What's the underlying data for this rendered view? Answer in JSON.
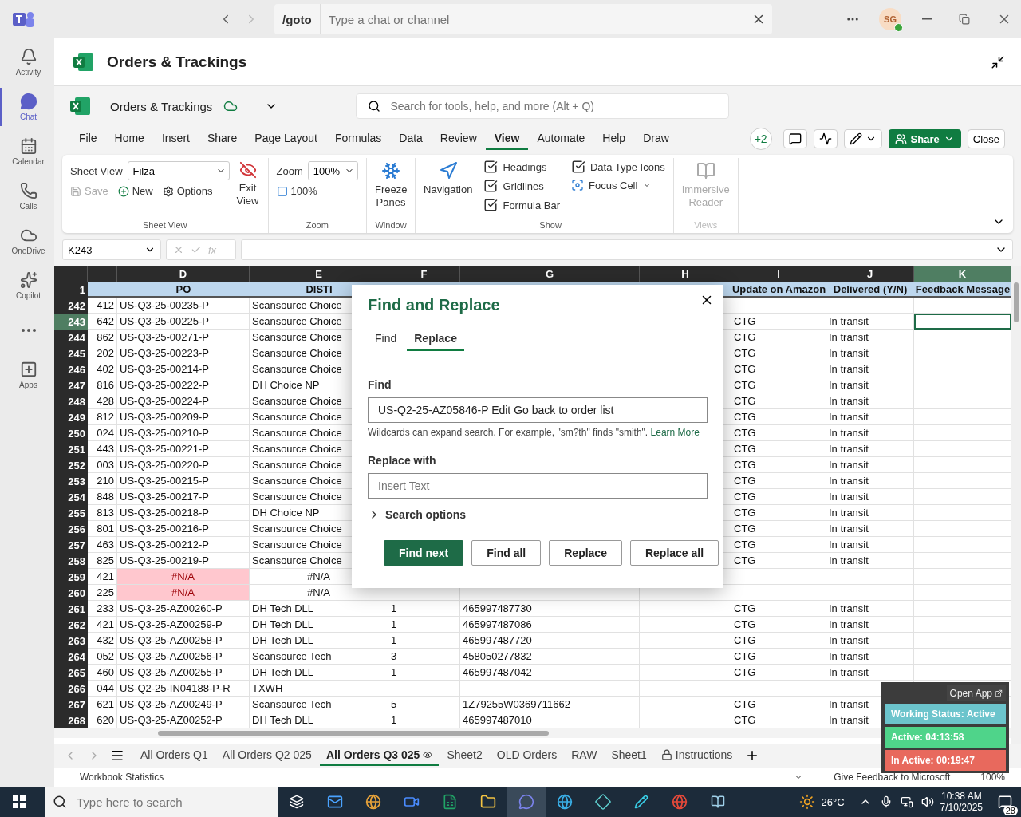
{
  "titlebar": {
    "command": "/goto",
    "search_placeholder": "Type a chat or channel",
    "avatar": "SG"
  },
  "rail": [
    {
      "label": "Activity",
      "kind": "bell",
      "selected": false
    },
    {
      "label": "Chat",
      "kind": "chat",
      "selected": true
    },
    {
      "label": "Calendar",
      "kind": "calendar",
      "selected": false
    },
    {
      "label": "Calls",
      "kind": "phone",
      "selected": false
    },
    {
      "label": "OneDrive",
      "kind": "cloud",
      "selected": false
    },
    {
      "label": "Copilot",
      "kind": "copilot",
      "selected": false
    },
    {
      "kind": "more",
      "selected": false
    },
    {
      "label": "Apps",
      "kind": "apps",
      "selected": false
    }
  ],
  "header": {
    "title": "Orders & Trackings"
  },
  "workbook": {
    "name": "Orders & Trackings",
    "search_placeholder": "Search for tools, help, and more (Alt + Q)"
  },
  "menu": [
    {
      "label": "File",
      "selected": false
    },
    {
      "label": "Home",
      "selected": false
    },
    {
      "label": "Insert",
      "selected": false
    },
    {
      "label": "Share",
      "selected": false
    },
    {
      "label": "Page Layout",
      "selected": false
    },
    {
      "label": "Formulas",
      "selected": false
    },
    {
      "label": "Data",
      "selected": false
    },
    {
      "label": "Review",
      "selected": false
    },
    {
      "label": "View",
      "selected": true
    },
    {
      "label": "Automate",
      "selected": false
    },
    {
      "label": "Help",
      "selected": false
    },
    {
      "label": "Draw",
      "selected": false
    }
  ],
  "collab": {
    "count": "+2",
    "share": "Share",
    "close": "Close"
  },
  "ribbon": {
    "sheet_view": {
      "label": "Sheet View",
      "value": "Filza",
      "save": "Save",
      "save_disabled": true,
      "new": "New",
      "options": "Options",
      "exit": "Exit View",
      "group": "Sheet View"
    },
    "zoom": {
      "label": "Zoom",
      "value": "100%",
      "reset": "100%",
      "group": "Zoom"
    },
    "window": {
      "freeze": "Freeze Panes",
      "group": "Window"
    },
    "navigation": "Navigation",
    "show": {
      "group": "Show",
      "checks": [
        {
          "label": "Headings",
          "checked": true
        },
        {
          "label": "Gridlines",
          "checked": true
        },
        {
          "label": "Formula Bar",
          "checked": true
        },
        {
          "label": "Data Type Icons",
          "checked": true
        }
      ],
      "focus": "Focus Cell"
    },
    "views": {
      "reader": "Immersive Reader",
      "group": "Views",
      "disabled": true
    }
  },
  "formula_bar": {
    "name_box": "K243",
    "fx": "fx"
  },
  "columns": [
    {
      "letter": "D",
      "selected": false
    },
    {
      "letter": "E",
      "selected": false
    },
    {
      "letter": "F",
      "selected": false
    },
    {
      "letter": "G",
      "selected": false
    },
    {
      "letter": "H",
      "selected": false
    },
    {
      "letter": "I",
      "selected": false
    },
    {
      "letter": "J",
      "selected": false
    },
    {
      "letter": "K",
      "selected": true
    }
  ],
  "header_row": {
    "row": "1",
    "d": "PO",
    "e": "DISTI",
    "i": "Update on Amazon",
    "j": "Delivered (Y/N)",
    "k": "Feedback Message"
  },
  "rows": [
    {
      "row": "242",
      "selected": false,
      "error": false,
      "c": "412",
      "d": "US-Q3-25-00235-P",
      "e": "Scansource Choice"
    },
    {
      "row": "243",
      "selected": true,
      "error": false,
      "c": "642",
      "d": "US-Q3-25-00225-P",
      "e": "Scansource Choice",
      "i": "CTG",
      "j": "In transit"
    },
    {
      "row": "244",
      "selected": false,
      "error": false,
      "c": "862",
      "d": "US-Q3-25-00271-P",
      "e": "Scansource Choice",
      "i": "CTG",
      "j": "In transit"
    },
    {
      "row": "245",
      "selected": false,
      "error": false,
      "c": "202",
      "d": "US-Q3-25-00223-P",
      "e": "Scansource Choice",
      "i": "CTG",
      "j": "In transit"
    },
    {
      "row": "246",
      "selected": false,
      "error": false,
      "c": "402",
      "d": "US-Q3-25-00214-P",
      "e": "Scansource Choice",
      "i": "CTG",
      "j": "In transit"
    },
    {
      "row": "247",
      "selected": false,
      "error": false,
      "c": "816",
      "d": "US-Q3-25-00222-P",
      "e": "DH Choice NP",
      "i": "CTG",
      "j": "In transit"
    },
    {
      "row": "248",
      "selected": false,
      "error": false,
      "c": "428",
      "d": "US-Q3-25-00224-P",
      "e": "Scansource Choice",
      "i": "CTG",
      "j": "In transit"
    },
    {
      "row": "249",
      "selected": false,
      "error": false,
      "c": "812",
      "d": "US-Q3-25-00209-P",
      "e": "Scansource Choice",
      "i": "CTG",
      "j": "In transit"
    },
    {
      "row": "250",
      "selected": false,
      "error": false,
      "c": "024",
      "d": "US-Q3-25-00210-P",
      "e": "Scansource Choice",
      "i": "CTG",
      "j": "In transit"
    },
    {
      "row": "251",
      "selected": false,
      "error": false,
      "c": "443",
      "d": "US-Q3-25-00221-P",
      "e": "Scansource Choice",
      "i": "CTG",
      "j": "In transit"
    },
    {
      "row": "252",
      "selected": false,
      "error": false,
      "c": "003",
      "d": "US-Q3-25-00220-P",
      "e": "Scansource Choice",
      "i": "CTG",
      "j": "In transit"
    },
    {
      "row": "253",
      "selected": false,
      "error": false,
      "c": "210",
      "d": "US-Q3-25-00215-P",
      "e": "Scansource Choice",
      "i": "CTG",
      "j": "In transit"
    },
    {
      "row": "254",
      "selected": false,
      "error": false,
      "c": "848",
      "d": "US-Q3-25-00217-P",
      "e": "Scansource Choice",
      "i": "CTG",
      "j": "In transit"
    },
    {
      "row": "255",
      "selected": false,
      "error": false,
      "c": "813",
      "d": "US-Q3-25-00218-P",
      "e": "DH Choice NP",
      "i": "CTG",
      "j": "In transit"
    },
    {
      "row": "256",
      "selected": false,
      "error": false,
      "c": "801",
      "d": "US-Q3-25-00216-P",
      "e": "Scansource Choice",
      "i": "CTG",
      "j": "In transit"
    },
    {
      "row": "257",
      "selected": false,
      "error": false,
      "c": "463",
      "d": "US-Q3-25-00212-P",
      "e": "Scansource Choice",
      "i": "CTG",
      "j": "In transit"
    },
    {
      "row": "258",
      "selected": false,
      "error": false,
      "c": "825",
      "d": "US-Q3-25-00219-P",
      "e": "Scansource Choice",
      "i": "CTG",
      "j": "In transit"
    },
    {
      "row": "259",
      "selected": false,
      "error": true,
      "c": "421",
      "d": "#N/A",
      "e": "#N/A"
    },
    {
      "row": "260",
      "selected": false,
      "error": true,
      "c": "225",
      "d": "#N/A",
      "e": "#N/A"
    },
    {
      "row": "261",
      "selected": false,
      "error": false,
      "c": "233",
      "d": "US-Q3-25-AZ00260-P",
      "e": "DH Tech DLL",
      "f": "1",
      "g": "465997487730",
      "i": "CTG",
      "j": "In transit"
    },
    {
      "row": "262",
      "selected": false,
      "error": false,
      "c": "421",
      "d": "US-Q3-25-AZ00259-P",
      "e": "DH Tech DLL",
      "f": "1",
      "g": "465997487086",
      "i": "CTG",
      "j": "In transit"
    },
    {
      "row": "263",
      "selected": false,
      "error": false,
      "c": "432",
      "d": "US-Q3-25-AZ00258-P",
      "e": "DH Tech DLL",
      "f": "1",
      "g": "465997487720",
      "i": "CTG",
      "j": "In transit"
    },
    {
      "row": "264",
      "selected": false,
      "error": false,
      "c": "052",
      "d": "US-Q3-25-AZ00256-P",
      "e": "Scansource Tech",
      "f": "3",
      "g": "458050277832",
      "i": "CTG",
      "j": "In transit"
    },
    {
      "row": "265",
      "selected": false,
      "error": false,
      "c": "460",
      "d": "US-Q3-25-AZ00255-P",
      "e": "DH Tech DLL",
      "f": "1",
      "g": "465997487042",
      "i": "CTG",
      "j": "In transit"
    },
    {
      "row": "266",
      "selected": false,
      "error": false,
      "c": "044",
      "d": "US-Q2-25-IN04188-P-R",
      "e": "TXWH"
    },
    {
      "row": "267",
      "selected": false,
      "error": false,
      "c": "621",
      "d": "US-Q3-25-AZ00249-P",
      "e": "Scansource Tech",
      "f": "5",
      "g": "1Z79255W0369711662",
      "i": "CTG",
      "j": "In transit"
    },
    {
      "row": "268",
      "selected": false,
      "error": false,
      "c": "620",
      "d": "US-Q3-25-AZ00252-P",
      "e": "DH Tech DLL",
      "f": "1",
      "g": "465997487010",
      "i": "CTG",
      "j": "In transit"
    }
  ],
  "dialog": {
    "title": "Find and Replace",
    "tabs": [
      {
        "label": "Find",
        "selected": false
      },
      {
        "label": "Replace",
        "selected": true
      }
    ],
    "find_label": "Find",
    "find_value": "US-Q2-25-AZ05846-P Edit Go back to order list",
    "hint": "Wildcards can expand search. For example, \"sm?th\" finds \"smith\".",
    "hint_link": "Learn More",
    "replace_label": "Replace with",
    "replace_placeholder": "Insert Text",
    "search_options": "Search options",
    "search_options_expanded": false,
    "buttons": [
      {
        "label": "Find next",
        "kind": "primary"
      },
      {
        "label": "Find all",
        "kind": "secondary"
      },
      {
        "label": "Replace",
        "kind": "secondary"
      },
      {
        "label": "Replace all",
        "kind": "secondary"
      }
    ]
  },
  "sheets": [
    {
      "label": "All Orders Q1",
      "selected": false,
      "kind": "plain"
    },
    {
      "label": "All Orders Q2 025",
      "selected": false,
      "kind": "plain"
    },
    {
      "label": "All Orders Q3 025",
      "selected": true,
      "kind": "view"
    },
    {
      "label": "Sheet2",
      "selected": false,
      "kind": "plain"
    },
    {
      "label": "OLD Orders",
      "selected": false,
      "kind": "plain"
    },
    {
      "label": "RAW",
      "selected": false,
      "kind": "plain"
    },
    {
      "label": "Sheet1",
      "selected": false,
      "kind": "plain"
    },
    {
      "label": "Instructions",
      "selected": false,
      "kind": "locked"
    }
  ],
  "status_bar": {
    "left": "Workbook Statistics",
    "feedback": "Give Feedback to Microsoft",
    "zoom": "100%"
  },
  "widget": {
    "open": "Open App",
    "items": [
      {
        "label": "Working Status: Active",
        "color": "#6cc4cc"
      },
      {
        "label": "Active: 04:13:58",
        "color": "#4fd48a"
      },
      {
        "label": "In Active: 00:19:47",
        "color": "#e8695d"
      }
    ]
  },
  "taskbar": {
    "search_placeholder": "Type here to search",
    "weather": "26°C",
    "time": "10:38 AM",
    "date": "7/10/2025",
    "notifications": "28"
  }
}
